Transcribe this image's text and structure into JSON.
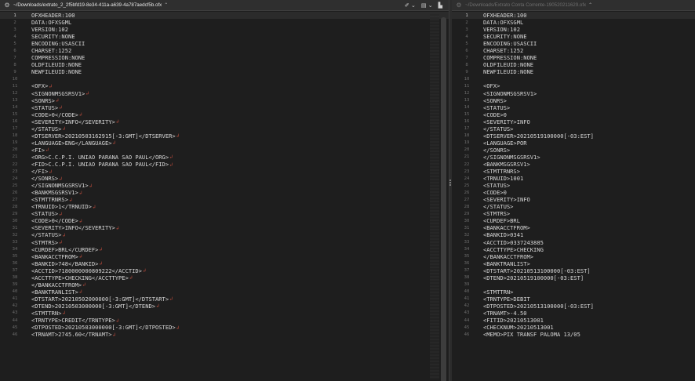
{
  "colors": {
    "bg": "#1e1e1e",
    "text": "#d8d8d8",
    "eol_marker": "#c14d3c",
    "gutter": "#6b6b6b"
  },
  "left": {
    "tab_icon": "gear-icon",
    "tab_path": "~/Downloads/extrato_2_2f5bfd19-8e34-411a-a639-4a787aedcf5b.ofx",
    "tab_chevron": "⌃",
    "tools": [
      "✐ ⌄",
      "▤ ⌄",
      "▙"
    ],
    "lines": [
      {
        "n": "1",
        "t": "OFXHEADER:100"
      },
      {
        "n": "2",
        "t": "DATA:OFXSGML"
      },
      {
        "n": "3",
        "t": "VERSION:102"
      },
      {
        "n": "4",
        "t": "SECURITY:NONE"
      },
      {
        "n": "5",
        "t": "ENCODING:USASCII"
      },
      {
        "n": "6",
        "t": "CHARSET:1252"
      },
      {
        "n": "7",
        "t": "COMPRESSION:NONE"
      },
      {
        "n": "8",
        "t": "OLDFILEUID:NONE"
      },
      {
        "n": "9",
        "t": "NEWFILEUID:NONE"
      },
      {
        "n": "10",
        "t": ""
      },
      {
        "n": "11",
        "t": "<OFX>",
        "e": "↲"
      },
      {
        "n": "12",
        "t": "<SIGNONMSGSRSV1>",
        "e": "↲"
      },
      {
        "n": "13",
        "t": "<SONRS>",
        "e": "↲"
      },
      {
        "n": "14",
        "t": "<STATUS>",
        "e": "↲"
      },
      {
        "n": "15",
        "t": "<CODE>0</CODE>",
        "e": "↲"
      },
      {
        "n": "16",
        "t": "<SEVERITY>INFO</SEVERITY>",
        "e": "↲"
      },
      {
        "n": "17",
        "t": "</STATUS>",
        "e": "↲"
      },
      {
        "n": "18",
        "t": "<DTSERVER>20210503162915[-3:GMT]</DTSERVER>",
        "e": "↲"
      },
      {
        "n": "19",
        "t": "<LANGUAGE>ENG</LANGUAGE>",
        "e": "↲"
      },
      {
        "n": "20",
        "t": "<FI>",
        "e": "↲"
      },
      {
        "n": "21",
        "t": "<ORG>C.C.P.I. UNIAO PARANA SAO PAUL</ORG>",
        "e": "↲"
      },
      {
        "n": "22",
        "t": "<FID>C.C.P.I. UNIAO PARANA SAO PAUL</FID>",
        "e": "↲"
      },
      {
        "n": "23",
        "t": "</FI>",
        "e": "↲"
      },
      {
        "n": "24",
        "t": "</SONRS>",
        "e": "↲"
      },
      {
        "n": "25",
        "t": "</SIGNONMSGSRSV1>",
        "e": "↲"
      },
      {
        "n": "26",
        "t": "<BANKMSGSRSV1>",
        "e": "↲"
      },
      {
        "n": "27",
        "t": "<STMTTRNRS>",
        "e": "↲"
      },
      {
        "n": "28",
        "t": "<TRNUID>1</TRNUID>",
        "e": "↲"
      },
      {
        "n": "29",
        "t": "<STATUS>",
        "e": "↲"
      },
      {
        "n": "30",
        "t": "<CODE>0</CODE>",
        "e": "↲"
      },
      {
        "n": "31",
        "t": "<SEVERITY>INFO</SEVERITY>",
        "e": "↲"
      },
      {
        "n": "32",
        "t": "</STATUS>",
        "e": "↲"
      },
      {
        "n": "33",
        "t": "<STMTRS>",
        "e": "↲"
      },
      {
        "n": "34",
        "t": "<CURDEF>BRL</CURDEF>",
        "e": "↲"
      },
      {
        "n": "35",
        "t": "<BANKACCTFROM>",
        "e": "↲"
      },
      {
        "n": "36",
        "t": "<BANKID>748</BANKID>",
        "e": "↲"
      },
      {
        "n": "37",
        "t": "<ACCTID>7180000000809222</ACCTID>",
        "e": "↲"
      },
      {
        "n": "38",
        "t": "<ACCTTYPE>CHECKING</ACCTTYPE>",
        "e": "↲"
      },
      {
        "n": "39",
        "t": "</BANKACCTFROM>",
        "e": "↲"
      },
      {
        "n": "40",
        "t": "<BANKTRANLIST>",
        "e": "↲"
      },
      {
        "n": "41",
        "t": "<DTSTART>20210502000000[-3:GMT]</DTSTART>",
        "e": "↲"
      },
      {
        "n": "42",
        "t": "<DTEND>20210503000000[-3:GMT]</DTEND>",
        "e": "↲"
      },
      {
        "n": "43",
        "t": "<STMTTRN>",
        "e": "↲"
      },
      {
        "n": "44",
        "t": "<TRNTYPE>CREDIT</TRNTYPE>",
        "e": "↲"
      },
      {
        "n": "45",
        "t": "<DTPOSTED>20210503000000[-3:GMT]</DTPOSTED>",
        "e": "↲"
      },
      {
        "n": "46",
        "t": "<TRNAMT>2745.60</TRNAMT>",
        "e": "↲"
      }
    ]
  },
  "right": {
    "tab_icon": "gear-icon",
    "tab_path": "~/Downloads/Extrato Conta Corrente-190520211629.ofx",
    "tab_chevron": "⌃",
    "lines": [
      {
        "n": "1",
        "t": "OFXHEADER:100"
      },
      {
        "n": "2",
        "t": "DATA:OFXSGML"
      },
      {
        "n": "3",
        "t": "VERSION:102"
      },
      {
        "n": "4",
        "t": "SECURITY:NONE"
      },
      {
        "n": "5",
        "t": "ENCODING:USASCII"
      },
      {
        "n": "6",
        "t": "CHARSET:1252"
      },
      {
        "n": "7",
        "t": "COMPRESSION:NONE"
      },
      {
        "n": "8",
        "t": "OLDFILEUID:NONE"
      },
      {
        "n": "9",
        "t": "NEWFILEUID:NONE"
      },
      {
        "n": "10",
        "t": ""
      },
      {
        "n": "11",
        "t": "<OFX>"
      },
      {
        "n": "12",
        "t": "<SIGNONMSGSRSV1>"
      },
      {
        "n": "13",
        "t": "<SONRS>"
      },
      {
        "n": "14",
        "t": "<STATUS>"
      },
      {
        "n": "15",
        "t": "<CODE>0"
      },
      {
        "n": "16",
        "t": "<SEVERITY>INFO"
      },
      {
        "n": "17",
        "t": "</STATUS>"
      },
      {
        "n": "18",
        "t": "<DTSERVER>20210519100000[-03:EST]"
      },
      {
        "n": "19",
        "t": "<LANGUAGE>POR"
      },
      {
        "n": "20",
        "t": "</SONRS>"
      },
      {
        "n": "21",
        "t": "</SIGNONMSGSRSV1>"
      },
      {
        "n": "22",
        "t": "<BANKMSGSRSV1>"
      },
      {
        "n": "23",
        "t": "<STMTTRNRS>"
      },
      {
        "n": "24",
        "t": "<TRNUID>1001"
      },
      {
        "n": "25",
        "t": "<STATUS>"
      },
      {
        "n": "26",
        "t": "<CODE>0"
      },
      {
        "n": "27",
        "t": "<SEVERITY>INFO"
      },
      {
        "n": "28",
        "t": "</STATUS>"
      },
      {
        "n": "29",
        "t": "<STMTRS>"
      },
      {
        "n": "30",
        "t": "<CURDEF>BRL"
      },
      {
        "n": "31",
        "t": "<BANKACCTFROM>"
      },
      {
        "n": "32",
        "t": "<BANKID>0341"
      },
      {
        "n": "33",
        "t": "<ACCTID>0337243885"
      },
      {
        "n": "34",
        "t": "<ACCTTYPE>CHECKING"
      },
      {
        "n": "35",
        "t": "</BANKACCTFROM>"
      },
      {
        "n": "36",
        "t": "<BANKTRANLIST>"
      },
      {
        "n": "37",
        "t": "<DTSTART>20210513100000[-03:EST]"
      },
      {
        "n": "38",
        "t": "<DTEND>20210519100000[-03:EST]"
      },
      {
        "n": "39",
        "t": ""
      },
      {
        "n": "40",
        "t": "<STMTTRN>"
      },
      {
        "n": "41",
        "t": "<TRNTYPE>DEBIT"
      },
      {
        "n": "42",
        "t": "<DTPOSTED>20210513100000[-03:EST]"
      },
      {
        "n": "43",
        "t": "<TRNAMT>-4.50"
      },
      {
        "n": "44",
        "t": "<FITID>20210513001"
      },
      {
        "n": "45",
        "t": "<CHECKNUM>20210513001"
      },
      {
        "n": "46",
        "t": "<MEMO>PIX TRANSF  PALOMA 13/05"
      }
    ]
  }
}
